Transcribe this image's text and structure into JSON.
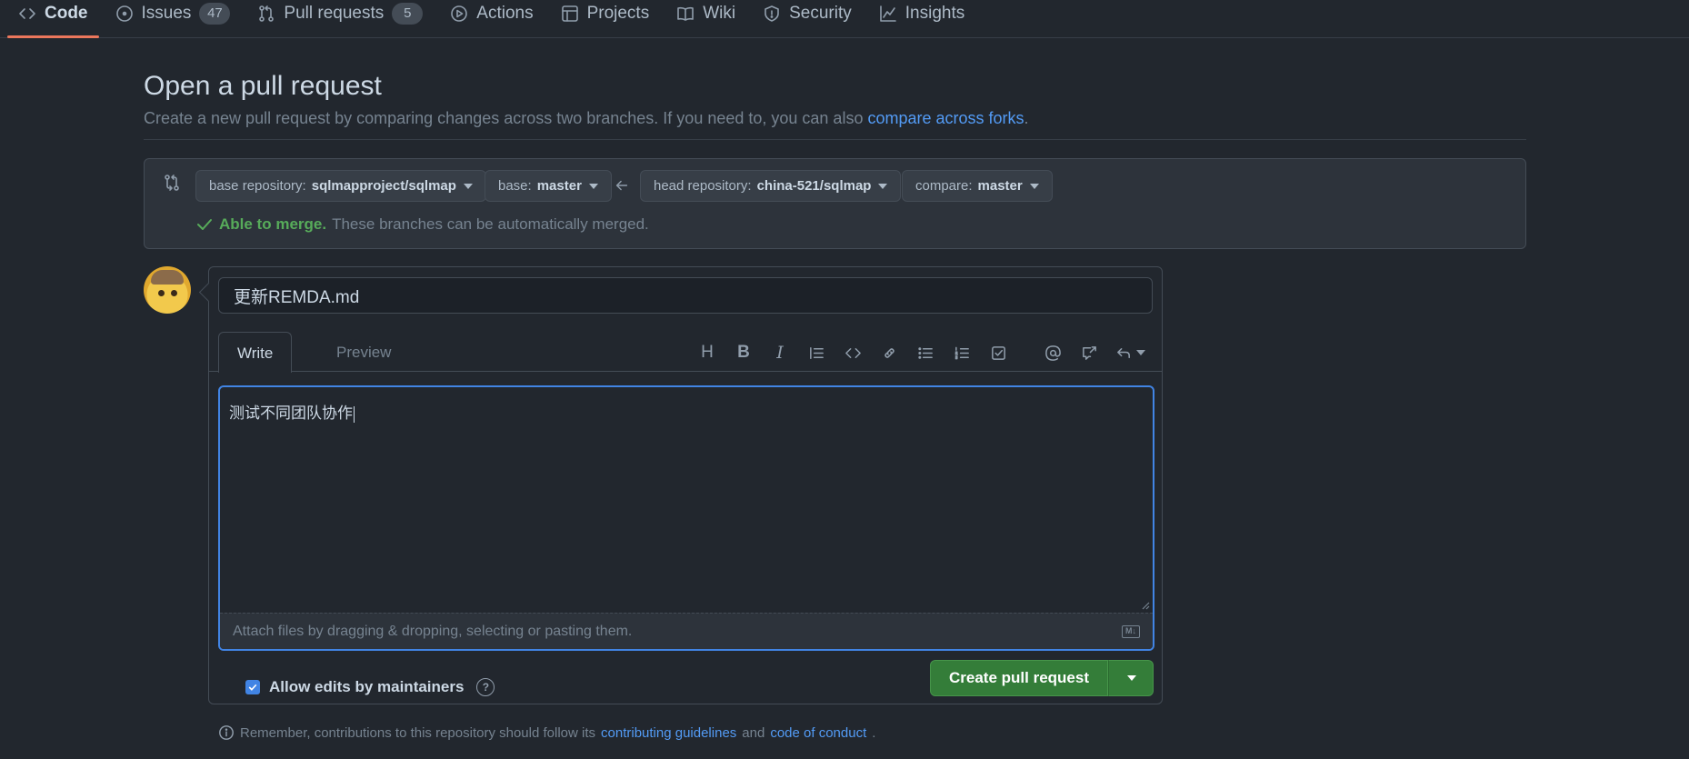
{
  "nav": {
    "tabs": [
      {
        "label": "Code",
        "icon": "code-icon"
      },
      {
        "label": "Issues",
        "icon": "issue-icon",
        "count": "47"
      },
      {
        "label": "Pull requests",
        "icon": "pull-request-icon",
        "count": "5"
      },
      {
        "label": "Actions",
        "icon": "play-icon"
      },
      {
        "label": "Projects",
        "icon": "table-icon"
      },
      {
        "label": "Wiki",
        "icon": "book-icon"
      },
      {
        "label": "Security",
        "icon": "shield-icon"
      },
      {
        "label": "Insights",
        "icon": "graph-icon"
      }
    ]
  },
  "header": {
    "title": "Open a pull request",
    "subtitle": "Create a new pull request by comparing changes across two branches. If you need to, you can also",
    "fork_link": "compare across forks",
    "period": "."
  },
  "compare": {
    "base_repo_label": "base repository:",
    "base_repo_value": "sqlmapproject/sqlmap",
    "base_label": "base:",
    "base_value": "master",
    "head_repo_label": "head repository:",
    "head_repo_value": "china-521/sqlmap",
    "compare_label": "compare:",
    "compare_value": "master",
    "merge_ok": "Able to merge.",
    "merge_text": "These branches can be automatically merged."
  },
  "composer": {
    "title_value": "更新REMDA.md",
    "tab_write": "Write",
    "tab_preview": "Preview",
    "toolbar_heading": "H",
    "toolbar_bold": "B",
    "toolbar_italic": "I",
    "body_value": "测试不同团队协作",
    "attach_hint": "Attach files by dragging & dropping, selecting or pasting them.",
    "md_badge": "M↓",
    "allow_edits": "Allow edits by maintainers",
    "help_glyph": "?",
    "create_button": "Create pull request"
  },
  "footer": {
    "remember_prefix": "Remember, contributions to this repository should follow its",
    "guidelines_link": "contributing guidelines",
    "and_text": "and",
    "conduct_link": "code of conduct",
    "period": "."
  },
  "colors": {
    "background": "#22272e",
    "accent_blue": "#539bf5",
    "success_green": "#57ab5a",
    "button_green": "#347d39",
    "tab_underline": "#ec775c"
  }
}
